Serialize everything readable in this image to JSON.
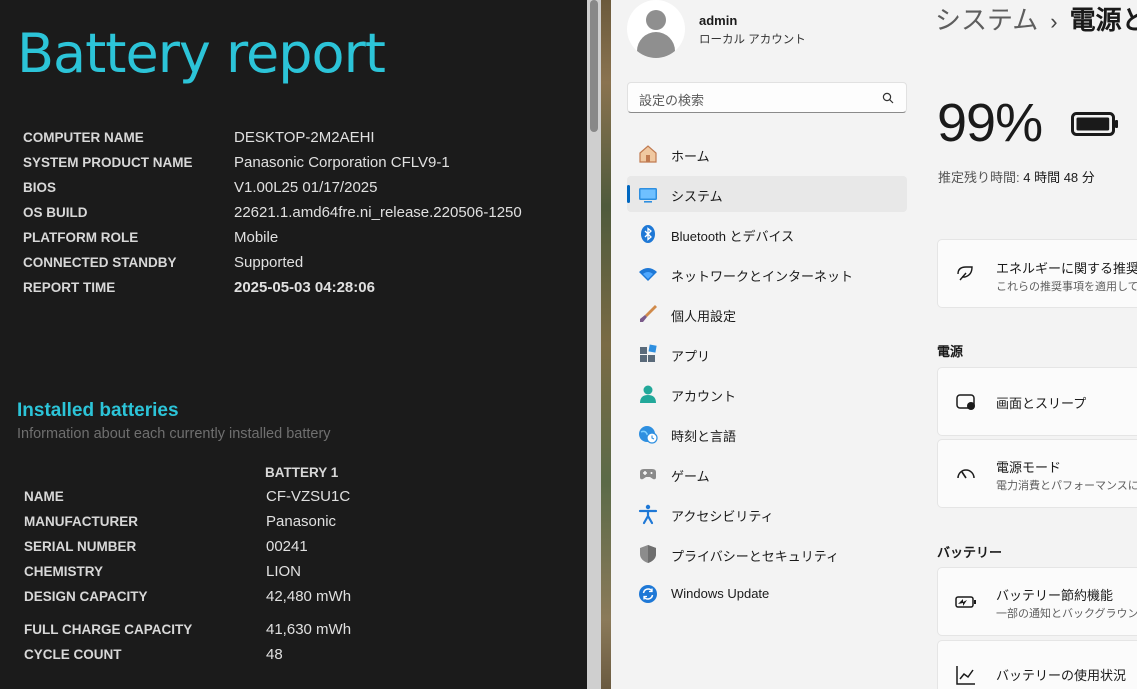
{
  "report": {
    "title": "Battery report",
    "system_info": [
      {
        "key": "COMPUTER NAME",
        "value": "DESKTOP-2M2AEHI"
      },
      {
        "key": "SYSTEM PRODUCT NAME",
        "value": "Panasonic Corporation CFLV9-1"
      },
      {
        "key": "BIOS",
        "value": "V1.00L25 01/17/2025"
      },
      {
        "key": "OS BUILD",
        "value": "22621.1.amd64fre.ni_release.220506-1250"
      },
      {
        "key": "PLATFORM ROLE",
        "value": "Mobile"
      },
      {
        "key": "CONNECTED STANDBY",
        "value": "Supported"
      },
      {
        "key": "REPORT TIME",
        "value": "2025-05-03  04:28:06"
      }
    ],
    "installed_title": "Installed batteries",
    "installed_subtitle": "Information about each currently installed battery",
    "battery_header": "BATTERY 1",
    "battery_rows": [
      {
        "key": "NAME",
        "value": "CF-VZSU1C"
      },
      {
        "key": "MANUFACTURER",
        "value": "Panasonic"
      },
      {
        "key": "SERIAL NUMBER",
        "value": "00241"
      },
      {
        "key": "CHEMISTRY",
        "value": "LION"
      },
      {
        "key": "DESIGN CAPACITY",
        "value": "42,480 mWh"
      },
      {
        "key": "FULL CHARGE CAPACITY",
        "value": "41,630 mWh"
      },
      {
        "key": "CYCLE COUNT",
        "value": "48"
      }
    ]
  },
  "settings": {
    "user": {
      "name": "admin",
      "account_type": "ローカル アカウント"
    },
    "search": {
      "placeholder": "設定の検索",
      "icon": "search-icon"
    },
    "nav": [
      {
        "label": "ホーム",
        "icon": "home-icon"
      },
      {
        "label": "システム",
        "icon": "system-icon",
        "active": true
      },
      {
        "label": "Bluetooth とデバイス",
        "icon": "bluetooth-icon"
      },
      {
        "label": "ネットワークとインターネット",
        "icon": "wifi-icon"
      },
      {
        "label": "個人用設定",
        "icon": "brush-icon"
      },
      {
        "label": "アプリ",
        "icon": "apps-icon"
      },
      {
        "label": "アカウント",
        "icon": "account-icon"
      },
      {
        "label": "時刻と言語",
        "icon": "globe-clock-icon"
      },
      {
        "label": "ゲーム",
        "icon": "gamepad-icon"
      },
      {
        "label": "アクセシビリティ",
        "icon": "accessibility-icon"
      },
      {
        "label": "プライバシーとセキュリティ",
        "icon": "shield-icon"
      },
      {
        "label": "Windows Update",
        "icon": "update-icon"
      }
    ],
    "breadcrumb": {
      "parent": "システム",
      "separator": "›",
      "current": "電源と"
    },
    "battery_percent": "99%",
    "battery_level": 0.99,
    "remaining_label": "推定残り時間: ",
    "remaining_value": "4 時間 48 分",
    "energy_card": {
      "title": "エネルギーに関する推奨事",
      "subtitle": "これらの推奨事項を適用してエ"
    },
    "power_section": "電源",
    "screen_sleep": {
      "title": "画面とスリープ"
    },
    "power_mode": {
      "title": "電源モード",
      "subtitle": "電力消費とパフォーマンスに基"
    },
    "battery_section": "バッテリー",
    "battery_saver": {
      "title": "バッテリー節約機能",
      "subtitle": "一部の通知とバックグラウンド"
    },
    "battery_usage": {
      "title": "バッテリーの使用状況"
    }
  }
}
